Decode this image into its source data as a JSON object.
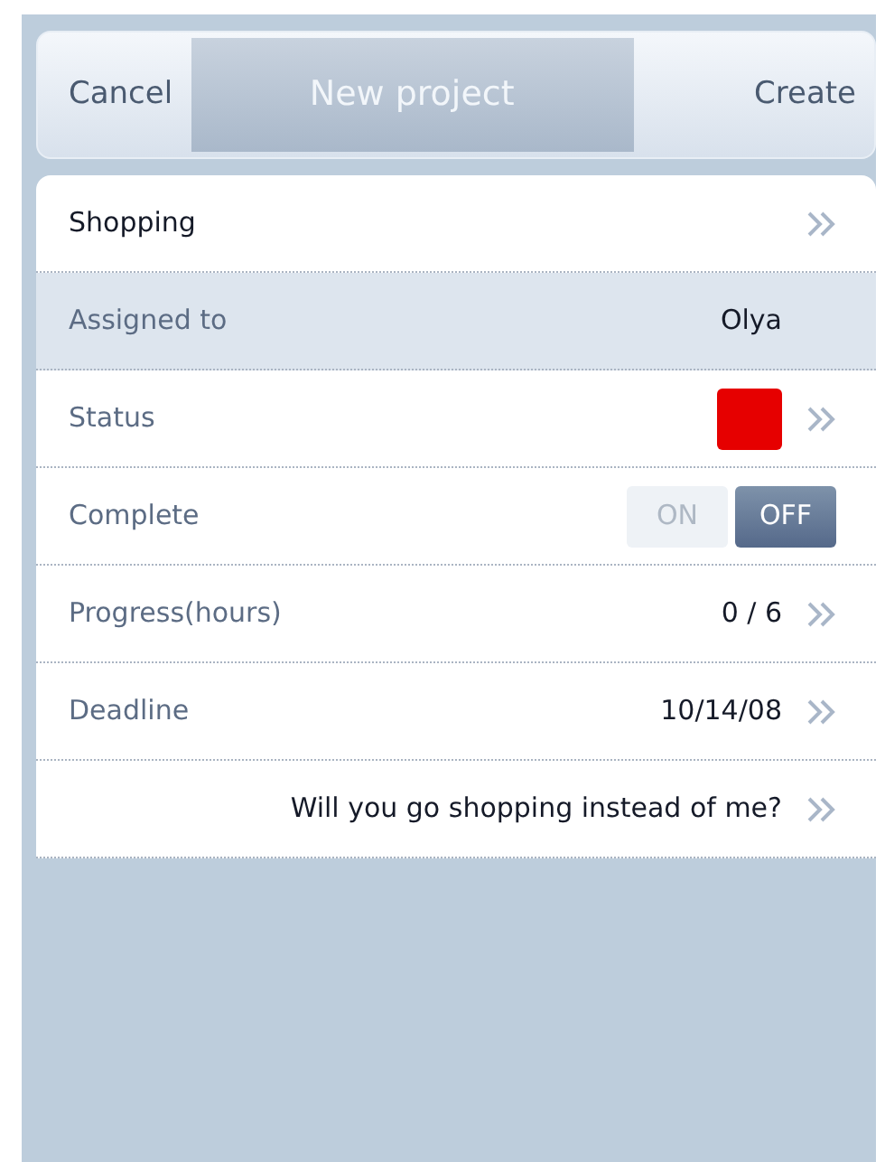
{
  "header": {
    "cancel": "Cancel",
    "title": "New project",
    "create": "Create"
  },
  "rows": [
    {
      "kind": "link",
      "label": "Shopping",
      "selected": false,
      "chevron": true
    },
    {
      "kind": "value",
      "label": "Assigned to",
      "value": "Olya",
      "selected": true,
      "chevron": false
    },
    {
      "kind": "status",
      "label": "Status",
      "color": "#e60000",
      "selected": false,
      "chevron": true
    },
    {
      "kind": "toggle",
      "label": "Complete",
      "on_label": "ON",
      "off_label": "OFF",
      "on": false,
      "selected": false,
      "chevron": false
    },
    {
      "kind": "value",
      "label": "Progress(hours)",
      "value": "0 / 6",
      "selected": false,
      "chevron": true
    },
    {
      "kind": "value",
      "label": "Deadline",
      "value": "10/14/08",
      "selected": false,
      "chevron": true
    },
    {
      "kind": "note",
      "value": "Will you go shopping instead of me?",
      "selected": false,
      "chevron": true
    }
  ]
}
